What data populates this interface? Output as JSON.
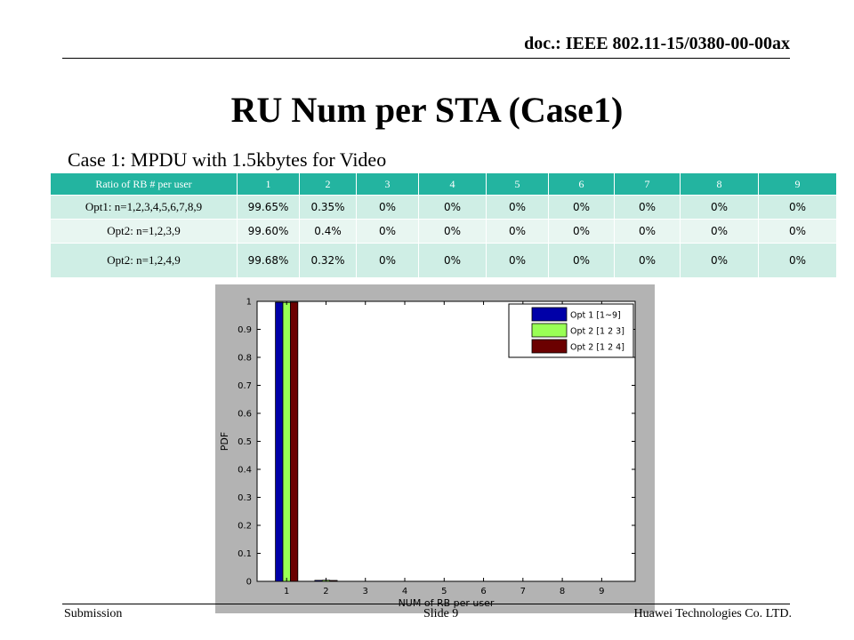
{
  "header": {
    "doc_id": "doc.: IEEE 802.11-15/0380-00-00ax"
  },
  "slide": {
    "title": "RU Num per STA (Case1)",
    "subtitle": "Case 1: MPDU with 1.5kbytes for Video"
  },
  "table": {
    "headers": [
      "Ratio of RB # per user",
      "1",
      "2",
      "3",
      "4",
      "5",
      "6",
      "7",
      "8",
      "9"
    ],
    "rows": [
      [
        "Opt1: n=1,2,3,4,5,6,7,8,9",
        "99.65%",
        "0.35%",
        "0%",
        "0%",
        "0%",
        "0%",
        "0%",
        "0%",
        "0%"
      ],
      [
        "Opt2: n=1,2,3,9",
        "99.60%",
        "0.4%",
        "0%",
        "0%",
        "0%",
        "0%",
        "0%",
        "0%",
        "0%"
      ],
      [
        "Opt2: n=1,2,4,9",
        "99.68%",
        "0.32%",
        "0%",
        "0%",
        "0%",
        "0%",
        "0%",
        "0%",
        "0%"
      ]
    ]
  },
  "chart_data": {
    "type": "bar",
    "categories": [
      1,
      2,
      3,
      4,
      5,
      6,
      7,
      8,
      9
    ],
    "series": [
      {
        "name": "Opt 1 [1~9]",
        "color": "#0000a8",
        "values": [
          0.9965,
          0.0035,
          0,
          0,
          0,
          0,
          0,
          0,
          0
        ]
      },
      {
        "name": "Opt 2 [1  2  3]",
        "color": "#99ff55",
        "values": [
          0.996,
          0.004,
          0,
          0,
          0,
          0,
          0,
          0,
          0
        ]
      },
      {
        "name": "Opt 2 [1  2  4]",
        "color": "#6b0000",
        "values": [
          0.9968,
          0.0032,
          0,
          0,
          0,
          0,
          0,
          0,
          0
        ]
      }
    ],
    "xlabel": "NUM of RB per user",
    "ylabel": "PDF",
    "xlim": [
      0.25,
      9.85
    ],
    "ylim": [
      0,
      1
    ],
    "yticks": [
      "0",
      "0.1",
      "0.2",
      "0.3",
      "0.4",
      "0.5",
      "0.6",
      "0.7",
      "0.8",
      "0.9",
      "1"
    ],
    "xticks": [
      "1",
      "2",
      "3",
      "4",
      "5",
      "6",
      "7",
      "8",
      "9"
    ],
    "grid": false,
    "legend": "top-right",
    "figure_background": "#b3b3b3"
  },
  "footer": {
    "left": "Submission",
    "center": "Slide 9",
    "right": "Huawei Technologies Co. LTD."
  }
}
